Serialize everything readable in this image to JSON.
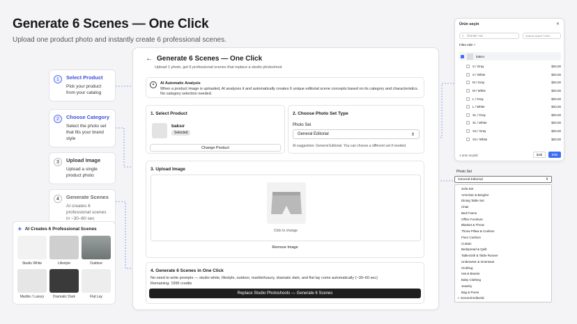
{
  "header": {
    "title": "Generate 6 Scenes — One Click",
    "subtitle": "Upload one product photo and instantly create 6 professional scenes."
  },
  "steps": [
    {
      "num": "1",
      "title": "Select Product",
      "desc": "Pick your product from your catalog"
    },
    {
      "num": "2",
      "title": "Choose Category",
      "desc": "Select the photo set that fits your brand style"
    },
    {
      "num": "3",
      "title": "Upload Image",
      "desc": "Upload a single product photo"
    },
    {
      "num": "4",
      "title": "Generate Scenes",
      "desc": "AI creates 6 professional scenes in ~30–60 sec"
    }
  ],
  "gallery": {
    "title": "AI Creates 6 Professional Scenes",
    "items": [
      "Studio White",
      "Lifestyle",
      "Outdoor",
      "Marble / Luxury",
      "Dramatic Dark",
      "Flat Lay"
    ]
  },
  "main": {
    "title": "Generate 6 Scenes — One Click",
    "subtitle": "Upload 1 photo, get 6 professional scenes that replace a studio photoshoot",
    "info_title": "AI Automatic Analysis",
    "info_text": "When a product image is uploaded, AI analyzes it and automatically creates 6 unique editorial scene concepts based on its category and characteristics. No category selection needed.",
    "select_product": {
      "title": "1. Select Product",
      "product_name": "baksır",
      "badge": "Selected",
      "change_button": "Change Product"
    },
    "photo_set": {
      "title": "2. Choose Photo Set Type",
      "label": "Photo Set",
      "value": "General Editorial",
      "hint": "AI suggestion: General Editorial. You can choose a different set if needed."
    },
    "upload": {
      "title": "3. Upload Image",
      "caption": "Click to change",
      "remove": "Remove Image"
    },
    "generate": {
      "title": "4. Generate 6 Scenes in One Click",
      "desc": "No need to write prompts — studio white, lifestyle, outdoor, marble/luxury, dramatic dark, and flat lay come automatically (~30–60 sec)",
      "remaining": "Remaining: 1995 credits",
      "button": "Replace Studio Photoshoots — Generate 6 Scenes"
    }
  },
  "modal": {
    "title": "Ürün seçin",
    "search_placeholder": "Ürünler Ara",
    "sort": "Arama seçimi Tümü",
    "filter": "Filtre ekle +",
    "product": "baksır",
    "variants": [
      {
        "name": "S  /  Gray",
        "price": "$20,00"
      },
      {
        "name": "S  /  White",
        "price": "$20,00"
      },
      {
        "name": "M  /  Gray",
        "price": "$20,00"
      },
      {
        "name": "M  /  White",
        "price": "$20,00"
      },
      {
        "name": "L  /  Gray",
        "price": "$20,00"
      },
      {
        "name": "L  /  White",
        "price": "$20,00"
      },
      {
        "name": "XL  /  Gray",
        "price": "$20,00"
      },
      {
        "name": "XL  /  White",
        "price": "$20,00"
      },
      {
        "name": "XS  /  Gray",
        "price": "$20,00"
      },
      {
        "name": "XS  /  White",
        "price": "$20,00"
      }
    ],
    "footer": "1 ürün seçildi",
    "cancel": "İptal",
    "ok": "Ekle"
  },
  "dropdown": {
    "label": "Photo Set",
    "value": "General Editorial",
    "options": [
      "Sofa Set",
      "Armchair & Bergère",
      "Dining Table Set",
      "Chair",
      "Bed Frame",
      "Office Furniture",
      "Blanket & Throw",
      "Throw Pillow & Cushion",
      "Floor Cushion",
      "Curtain",
      "Bedspread & Quilt",
      "Tablecloth & Table Runner",
      "Underwear & Innerwear",
      "Clothing",
      "Hat & Beanie",
      "Baby Clothing",
      "Jewelry",
      "Bag & Purse",
      "✓ General Editorial"
    ]
  }
}
